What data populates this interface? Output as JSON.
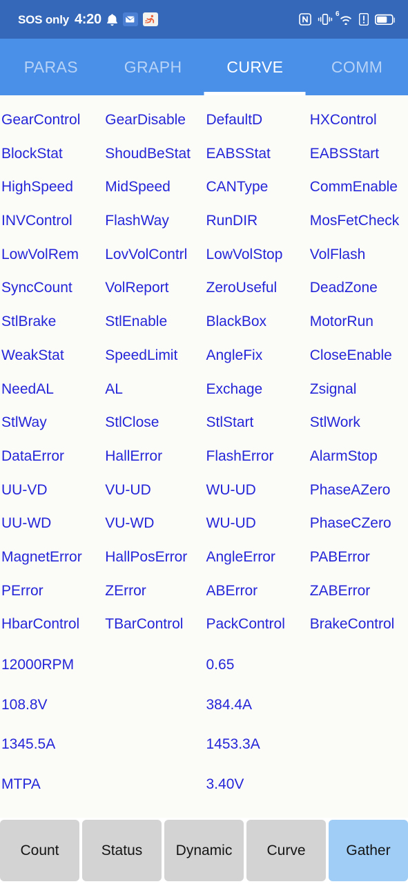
{
  "statusbar": {
    "carrier": "SOS only",
    "time": "4:20",
    "left_icons": [
      "bell-icon",
      "message-icon",
      "fitness-icon"
    ],
    "right_icons": [
      "nfc-icon",
      "vibrate-icon",
      "wifi-6-icon",
      "alert-icon",
      "battery-icon"
    ],
    "wifi_generation": "6",
    "background_color": "#3568b8"
  },
  "tabs": {
    "items": [
      {
        "label": "PARAS",
        "active": false
      },
      {
        "label": "GRAPH",
        "active": false
      },
      {
        "label": "CURVE",
        "active": true
      },
      {
        "label": "COMM",
        "active": false
      }
    ],
    "background_color": "#4a90e8",
    "active_color": "#ffffff",
    "inactive_color": "rgba(255,255,255,0.60)"
  },
  "grid": {
    "text_color": "#2526d8",
    "rows": [
      [
        "GearControl",
        "GearDisable",
        "DefaultD",
        "HXControl"
      ],
      [
        "BlockStat",
        "ShoudBeStat",
        "EABSStat",
        "EABSStart"
      ],
      [
        "HighSpeed",
        "MidSpeed",
        "CANType",
        "CommEnable"
      ],
      [
        "INVControl",
        "FlashWay",
        "RunDIR",
        "MosFetCheck"
      ],
      [
        "LowVolRem",
        "LovVolContrl",
        "LowVolStop",
        "VolFlash"
      ],
      [
        "SyncCount",
        "VolReport",
        "ZeroUseful",
        "DeadZone"
      ],
      [
        "StlBrake",
        "StlEnable",
        "BlackBox",
        "MotorRun"
      ],
      [
        "WeakStat",
        "SpeedLimit",
        "AngleFix",
        "CloseEnable"
      ],
      [
        "NeedAL",
        "AL",
        "Exchage",
        "Zsignal"
      ],
      [
        "StlWay",
        "StlClose",
        "StlStart",
        "StlWork"
      ],
      [
        "DataError",
        "HallError",
        "FlashError",
        "AlarmStop"
      ],
      [
        "UU-VD",
        "VU-UD",
        "WU-UD",
        "PhaseAZero"
      ],
      [
        "UU-WD",
        "VU-WD",
        "WU-UD",
        "PhaseCZero"
      ],
      [
        "MagnetError",
        "HallPosError",
        "AngleError",
        "PABError"
      ],
      [
        "PError",
        "ZError",
        "ABError",
        "ZABError"
      ],
      [
        "HbarControl",
        "TBarControl",
        "PackControl",
        "BrakeControl"
      ]
    ]
  },
  "values": {
    "text_color": "#2526d8",
    "rows": [
      [
        "12000RPM",
        "",
        "0.65",
        ""
      ],
      [
        "108.8V",
        "",
        "384.4A",
        ""
      ],
      [
        "1345.5A",
        "",
        "1453.3A",
        ""
      ],
      [
        "MTPA",
        "",
        "3.40V",
        ""
      ]
    ]
  },
  "bottombar": {
    "buttons": [
      {
        "label": "Count",
        "active": false
      },
      {
        "label": "Status",
        "active": false
      },
      {
        "label": "Dynamic",
        "active": false
      },
      {
        "label": "Curve",
        "active": false
      },
      {
        "label": "Gather",
        "active": true
      }
    ],
    "inactive_color": "#d3d3d3",
    "active_color": "#9fcdf5"
  }
}
